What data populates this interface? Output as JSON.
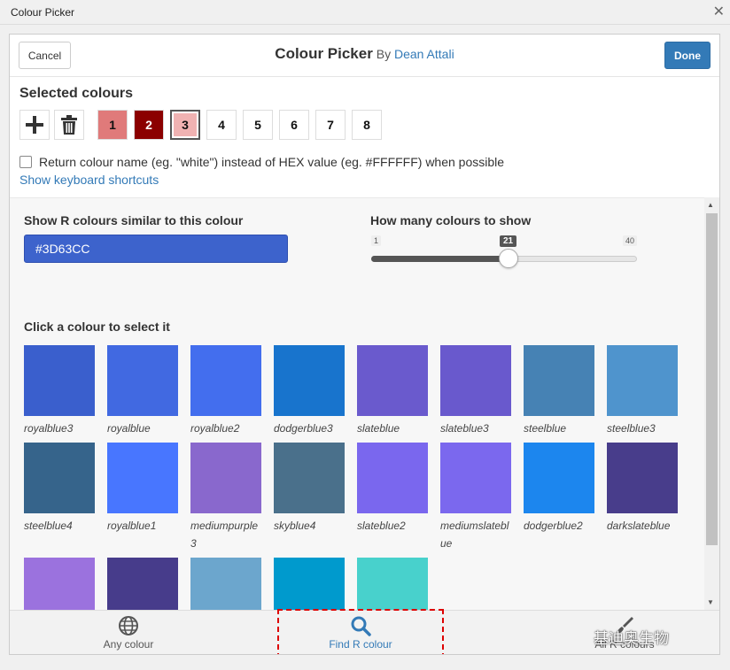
{
  "window": {
    "title": "Colour Picker"
  },
  "header": {
    "cancel_label": "Cancel",
    "title": "Colour Picker",
    "by": "By",
    "author": "Dean Attali",
    "done_label": "Done"
  },
  "selected": {
    "title": "Selected colours",
    "slots": [
      {
        "label": "1",
        "color": "#E07A7A",
        "text_color": "#111111"
      },
      {
        "label": "2",
        "color": "#8B0000",
        "text_color": "#FFFFFF"
      },
      {
        "label": "3",
        "color": "#F0B2B2",
        "text_color": "#111111",
        "active": true
      },
      {
        "label": "4",
        "color": "#FFFFFF",
        "text_color": "#111111"
      },
      {
        "label": "5",
        "color": "#FFFFFF",
        "text_color": "#111111"
      },
      {
        "label": "6",
        "color": "#FFFFFF",
        "text_color": "#111111"
      },
      {
        "label": "7",
        "color": "#FFFFFF",
        "text_color": "#111111"
      },
      {
        "label": "8",
        "color": "#FFFFFF",
        "text_color": "#111111"
      }
    ],
    "return_name_label": "Return colour name (eg. \"white\") instead of HEX value (eg. #FFFFFF) when possible",
    "keyboard_link": "Show keyboard shortcuts"
  },
  "similar": {
    "label": "Show R colours similar to this colour",
    "value": "#3D63CC",
    "input_color": "#3D63CC"
  },
  "count": {
    "label": "How many colours to show",
    "min": 1,
    "max": 40,
    "value": 21,
    "min_label": "1",
    "max_label": "40",
    "value_label": "21"
  },
  "grid": {
    "label": "Click a colour to select it",
    "colours": [
      {
        "name": "royalblue3",
        "color": "#3A5FCD"
      },
      {
        "name": "royalblue",
        "color": "#4169E1"
      },
      {
        "name": "royalblue2",
        "color": "#436EEE"
      },
      {
        "name": "dodgerblue3",
        "color": "#1874CD"
      },
      {
        "name": "slateblue",
        "color": "#6A5ACD"
      },
      {
        "name": "slateblue3",
        "color": "#6959CD"
      },
      {
        "name": "steelblue",
        "color": "#4682B4"
      },
      {
        "name": "steelblue3",
        "color": "#4F94CD"
      },
      {
        "name": "steelblue4",
        "color": "#36648B"
      },
      {
        "name": "royalblue1",
        "color": "#4876FF"
      },
      {
        "name": "mediumpurple3",
        "color": "#8968CD"
      },
      {
        "name": "skyblue4",
        "color": "#4A708B"
      },
      {
        "name": "slateblue2",
        "color": "#7A67EE"
      },
      {
        "name": "mediumslateblue",
        "color": "#7B68EE"
      },
      {
        "name": "dodgerblue2",
        "color": "#1C86EE"
      },
      {
        "name": "darkslateblue",
        "color": "#483D8B"
      },
      {
        "name": "",
        "color": "#9B72DE"
      },
      {
        "name": "",
        "color": "#473C8B"
      },
      {
        "name": "",
        "color": "#6CA6CD"
      },
      {
        "name": "",
        "color": "#009ACD"
      },
      {
        "name": "",
        "color": "#48D1CC"
      }
    ]
  },
  "footer": {
    "tabs": [
      {
        "label": "Any colour",
        "icon": "globe-icon"
      },
      {
        "label": "Find R colour",
        "icon": "search-icon"
      },
      {
        "label": "All R colours",
        "icon": "brush-icon"
      }
    ]
  },
  "watermark": "基迪奥生物"
}
